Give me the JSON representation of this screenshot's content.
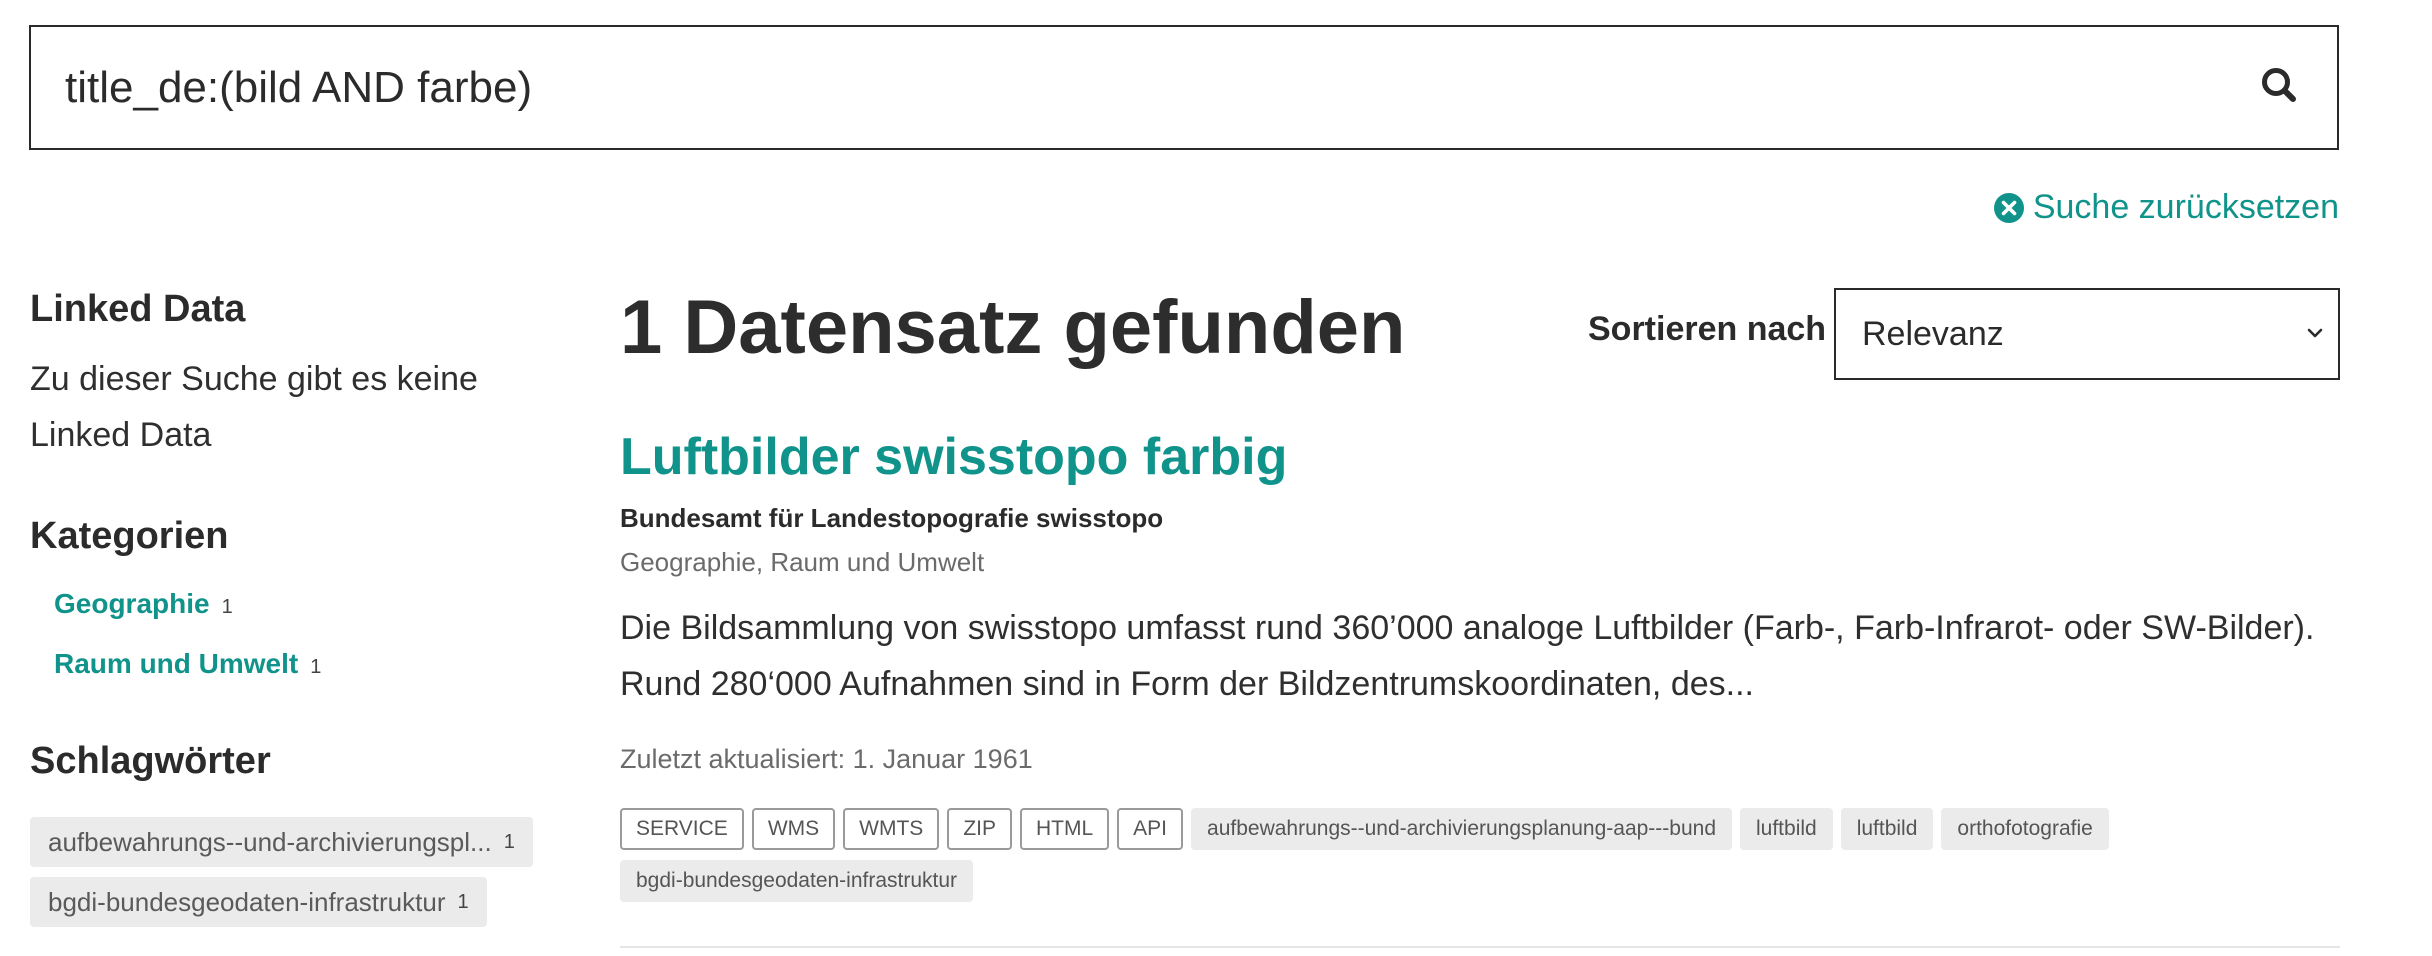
{
  "search": {
    "value": "title_de:(bild AND farbe)",
    "icon": "search-icon"
  },
  "reset": {
    "label": "Suche zurücksetzen",
    "icon": "close-circle-icon"
  },
  "sidebar": {
    "linked_data": {
      "heading": "Linked Data",
      "text": "Zu dieser Suche gibt es keine Linked Data"
    },
    "categories": {
      "heading": "Kategorien",
      "items": [
        {
          "label": "Geographie",
          "count": "1"
        },
        {
          "label": "Raum und Umwelt",
          "count": "1"
        }
      ]
    },
    "keywords": {
      "heading": "Schlagwörter",
      "items": [
        {
          "label": "aufbewahrungs--und-archivierungspl...",
          "count": "1"
        },
        {
          "label": "bgdi-bundesgeodaten-infrastruktur",
          "count": "1"
        }
      ]
    }
  },
  "results": {
    "count_text": "1 Datensatz gefunden",
    "sort": {
      "label": "Sortieren nach",
      "value": "Relevanz"
    },
    "items": [
      {
        "title": "Luftbilder swisstopo farbig",
        "publisher": "Bundesamt für Landestopografie swisstopo",
        "categories": "Geographie, Raum und Umwelt",
        "description": "Die Bildsammlung von swisstopo umfasst rund 360’000 analoge Luftbilder (Farb-, Farb-Infrarot- oder SW-Bilder). Rund 280‘000 Aufnahmen sind in Form der Bildzentrumskoordinaten, des...",
        "updated": "Zuletzt aktualisiert: 1. Januar 1961",
        "formats": [
          "SERVICE",
          "WMS",
          "WMTS",
          "ZIP",
          "HTML",
          "API"
        ],
        "keywords": [
          "aufbewahrungs--und-archivierungsplanung-aap---bund",
          "luftbild",
          "luftbild",
          "orthofotografie",
          "bgdi-bundesgeodaten-infrastruktur"
        ]
      }
    ]
  },
  "colors": {
    "accent": "#10938a",
    "text": "#2f2f2f",
    "muted": "#6b6b6b",
    "chip_bg": "#ebebeb"
  }
}
